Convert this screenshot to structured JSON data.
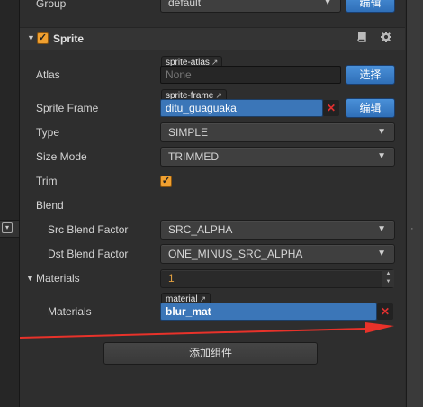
{
  "group_row": {
    "label": "Group",
    "value": "default",
    "edit_button": "编辑"
  },
  "sprite_section": {
    "title": "Sprite",
    "collapse_icon": "triangle-down",
    "book_icon": "book-icon",
    "gear_icon": "gear-icon"
  },
  "atlas": {
    "label": "Atlas",
    "tag": "sprite-atlas",
    "placeholder": "None",
    "button": "选择"
  },
  "sprite_frame": {
    "label": "Sprite Frame",
    "tag": "sprite-frame",
    "value": "ditu_guaguaka",
    "button": "编辑"
  },
  "type": {
    "label": "Type",
    "value": "SIMPLE"
  },
  "size_mode": {
    "label": "Size Mode",
    "value": "TRIMMED"
  },
  "trim": {
    "label": "Trim",
    "checked": true
  },
  "blend": {
    "label": "Blend"
  },
  "src_blend": {
    "label": "Src Blend Factor",
    "value": "SRC_ALPHA"
  },
  "dst_blend": {
    "label": "Dst Blend Factor",
    "value": "ONE_MINUS_SRC_ALPHA"
  },
  "materials_count": {
    "label": "Materials",
    "value": "1"
  },
  "materials_item": {
    "label": "Materials",
    "tag": "material",
    "value": "blur_mat"
  },
  "add_component": {
    "label": "添加组件"
  },
  "colors": {
    "accent_blue": "#3b76b8",
    "checkbox_orange": "#f0a030",
    "arrow_red": "#e8322a",
    "panel_bg": "#2e2e2e"
  }
}
